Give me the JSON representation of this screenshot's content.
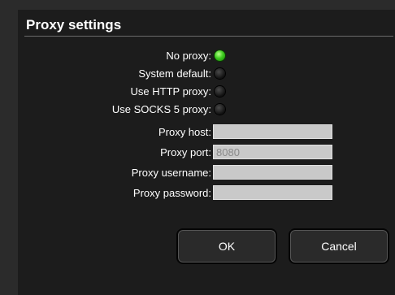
{
  "dialog": {
    "title": "Proxy settings",
    "options": [
      {
        "label": "No proxy:",
        "selected": true
      },
      {
        "label": "System default:",
        "selected": false
      },
      {
        "label": "Use HTTP proxy:",
        "selected": false
      },
      {
        "label": "Use SOCKS 5 proxy:",
        "selected": false
      }
    ],
    "fields": {
      "host": {
        "label": "Proxy host:",
        "value": ""
      },
      "port": {
        "label": "Proxy port:",
        "value": "8080"
      },
      "username": {
        "label": "Proxy username:",
        "value": ""
      },
      "password": {
        "label": "Proxy password:",
        "value": ""
      }
    },
    "buttons": {
      "ok": "OK",
      "cancel": "Cancel"
    }
  },
  "colors": {
    "radio_selected": "#3ecb1f",
    "background": "#1c1c1c",
    "field_background": "#c9c9c9"
  }
}
